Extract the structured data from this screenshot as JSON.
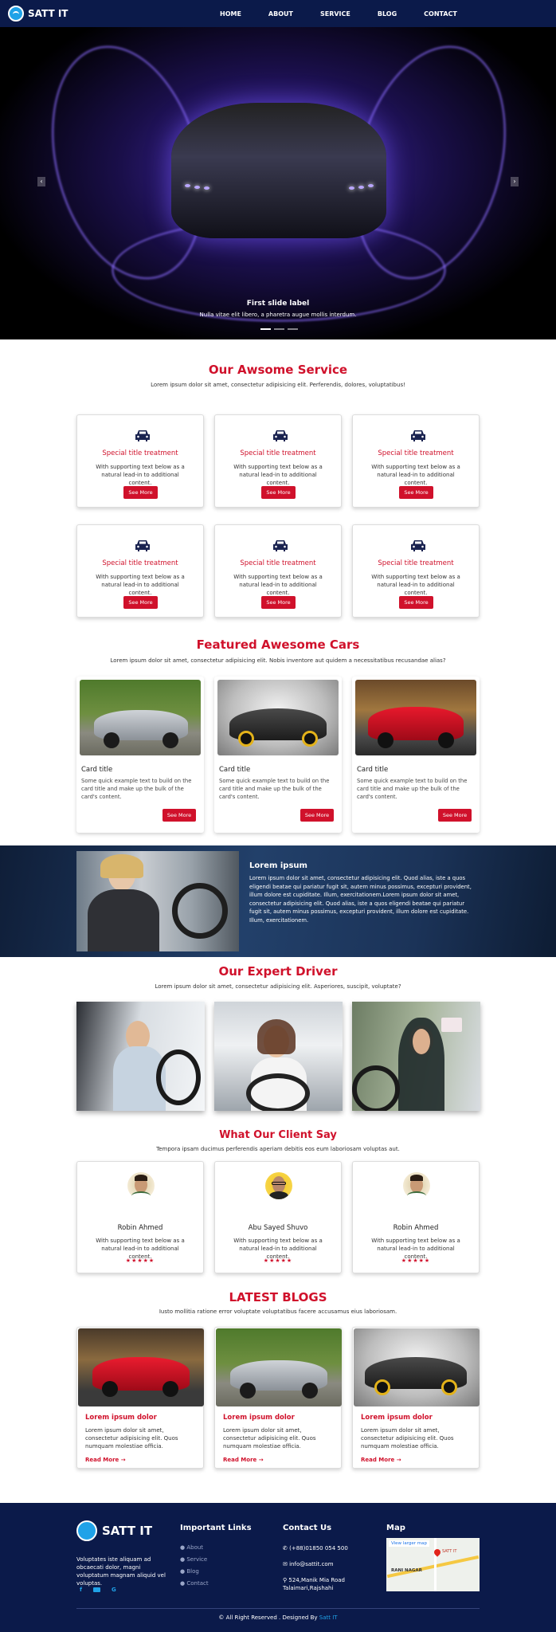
{
  "brand": {
    "name": "SATT IT"
  },
  "nav": {
    "items": [
      "HOME",
      "ABOUT",
      "SERVICE",
      "BLOG",
      "CONTACT"
    ]
  },
  "hero": {
    "title": "First slide label",
    "text": "Nulla vitae elit libero, a pharetra augue mollis interdum.",
    "prev": "‹",
    "next": "›"
  },
  "services": {
    "title": "Our Awsome Service",
    "subtitle": "Lorem ipsum dolor sit amet, consectetur adipisicing elit. Perferendis, dolores, voluptatibus!",
    "cards": [
      {
        "title": "Special title treatment",
        "text": "With supporting text below as a natural lead-in to additional content.",
        "button": "See More"
      },
      {
        "title": "Special title treatment",
        "text": "With supporting text below as a natural lead-in to additional content.",
        "button": "See More"
      },
      {
        "title": "Special title treatment",
        "text": "With supporting text below as a natural lead-in to additional content.",
        "button": "See More"
      },
      {
        "title": "Special title treatment",
        "text": "With supporting text below as a natural lead-in to additional content.",
        "button": "See More"
      },
      {
        "title": "Special title treatment",
        "text": "With supporting text below as a natural lead-in to additional content.",
        "button": "See More"
      },
      {
        "title": "Special title treatment",
        "text": "With supporting text below as a natural lead-in to additional content.",
        "button": "See More"
      }
    ]
  },
  "featured": {
    "title": "Featured Awesome Cars",
    "subtitle": "Lorem ipsum dolor sit amet, consectetur adipisicing elit. Nobis inventore aut quidem a necessitatibus recusandae alias?",
    "cards": [
      {
        "title": "Card title",
        "text": "Some quick example text to build on the card title and make up the bulk of the card's content.",
        "button": "See More"
      },
      {
        "title": "Card title",
        "text": "Some quick example text to build on the card title and make up the bulk of the card's content.",
        "button": "See More"
      },
      {
        "title": "Card title",
        "text": "Some quick example text to build on the card title and make up the bulk of the card's content.",
        "button": "See More"
      }
    ]
  },
  "about": {
    "title": "Lorem ipsum",
    "text": "Lorem ipsum dolor sit amet, consectetur adipisicing elit. Quod alias, iste a quos eligendi beatae qui pariatur fugit sit, autem minus possimus, excepturi provident, illum dolore est cupiditate. Illum, exercitationem.Lorem ipsum dolor sit amet, consectetur adipisicing elit. Quod alias, iste a quos eligendi beatae qui pariatur fugit sit, autem minus possimus, excepturi provident, illum dolore est cupiditate. Illum, exercitationem."
  },
  "drivers": {
    "title": "Our Expert Driver",
    "subtitle": "Lorem ipsum dolor sit amet, consectetur adipisicing elit. Asperiores, suscipit, voluptate?"
  },
  "clients": {
    "title": "What Our Client Say",
    "subtitle": "Tempora ipsam ducimus perferendis aperiam debitis eos eum laboriosam voluptas aut.",
    "cards": [
      {
        "name": "Robin Ahmed",
        "text": "With supporting text below as a natural lead-in to additional content.",
        "stars": "★★★★★"
      },
      {
        "name": "Abu Sayed Shuvo",
        "text": "With supporting text below as a natural lead-in to additional content.",
        "stars": "★★★★★"
      },
      {
        "name": "Robin Ahmed",
        "text": "With supporting text below as a natural lead-in to additional content.",
        "stars": "★★★★★"
      }
    ]
  },
  "blogs": {
    "title": "LATEST BLOGS",
    "subtitle": "Iusto mollitia ratione error voluptate voluptatibus facere accusamus eius laboriosam.",
    "cards": [
      {
        "title": "Lorem ipsum dolor",
        "text": "Lorem ipsum dolor sit amet, consectetur adipisicing elit. Quos numquam molestiae officia.",
        "link": "Read More →"
      },
      {
        "title": "Lorem ipsum dolor",
        "text": "Lorem ipsum dolor sit amet, consectetur adipisicing elit. Quos numquam molestiae officia.",
        "link": "Read More →"
      },
      {
        "title": "Lorem ipsum dolor",
        "text": "Lorem ipsum dolor sit amet, consectetur adipisicing elit. Quos numquam molestiae officia.",
        "link": "Read More →"
      }
    ]
  },
  "footer": {
    "about": "Voluptates iste aliquam ad obcaecati dolor, magni voluptatum magnam aliquid vel voluptas.",
    "links_title": "Important Links",
    "links": [
      "About",
      "Service",
      "Blog",
      "Contact"
    ],
    "contact_title": "Contact Us",
    "phone": "(+88)01850 054 500",
    "email": "info@sattit.com",
    "address": "524,Manik Mia Road Talaimari,Rajshahi",
    "map_title": "Map",
    "map_link": "View larger map",
    "map_place": "RANI NAGAR",
    "map_pin": "SATT IT",
    "copyright": "© All Right Reserved . Designed By",
    "designer": "Satt IT"
  },
  "colors": {
    "accent": "#d0112b",
    "navy": "#0b1a4a",
    "brand_blue": "#1fa2e8"
  }
}
